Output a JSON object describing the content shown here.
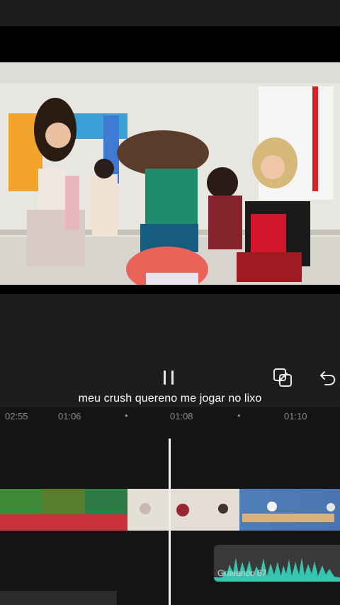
{
  "subtitle": "meu crush quereno me jogar no lixo",
  "ruler": {
    "labels": [
      "02:55",
      "01:06",
      "01:08",
      "01:10"
    ]
  },
  "audio": {
    "label": "Gravando 87"
  },
  "controls": {
    "play_icon": "pause-icon",
    "layer_icon": "keyframe-icon",
    "undo_icon": "undo-icon"
  },
  "colors": {
    "background": "#141414",
    "waveform": "#35c7b2",
    "playhead": "#f2f2f2"
  }
}
